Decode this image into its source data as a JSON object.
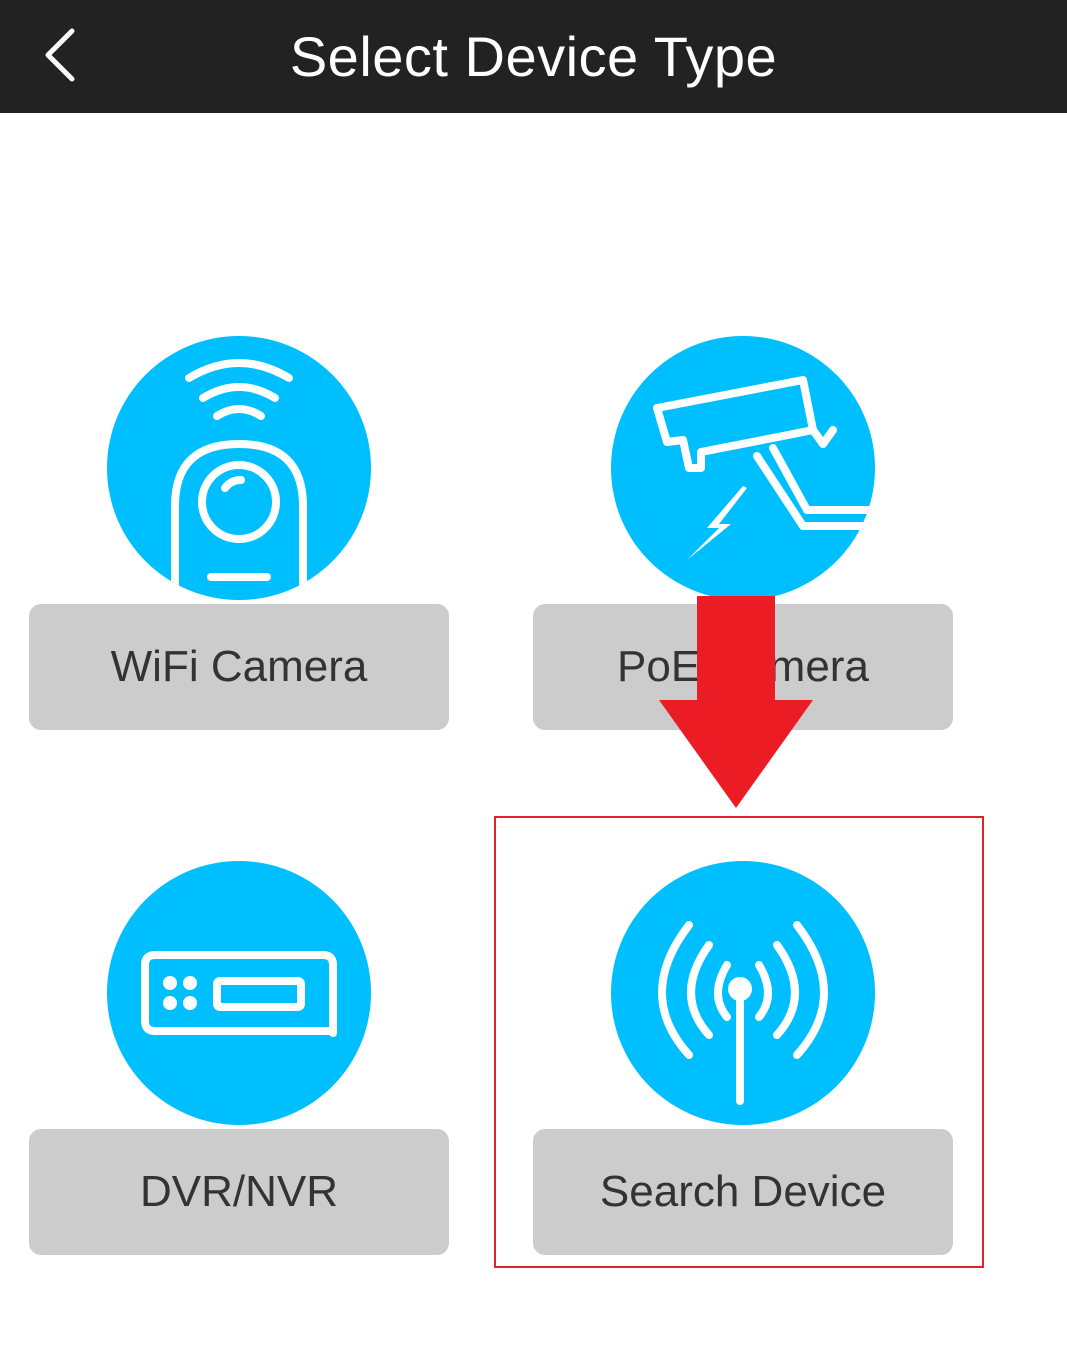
{
  "header": {
    "title": "Select Device Type",
    "back_icon": "chevron-left-icon"
  },
  "tiles": [
    {
      "label": "WiFi Camera",
      "icon": "wifi-camera-icon"
    },
    {
      "label": "PoE Camera",
      "icon": "poe-camera-icon"
    },
    {
      "label": "DVR/NVR",
      "icon": "dvr-nvr-icon"
    },
    {
      "label": "Search Device",
      "icon": "antenna-signal-icon"
    }
  ],
  "annotation": {
    "arrow_icon": "red-down-arrow-icon",
    "highlighted_tile": "Search Device"
  },
  "colors": {
    "header_bg": "#222222",
    "icon_circle": "#00bfff",
    "tile_button": "#cccccc",
    "tile_text": "#333333",
    "annotation_red": "#e0242a"
  }
}
